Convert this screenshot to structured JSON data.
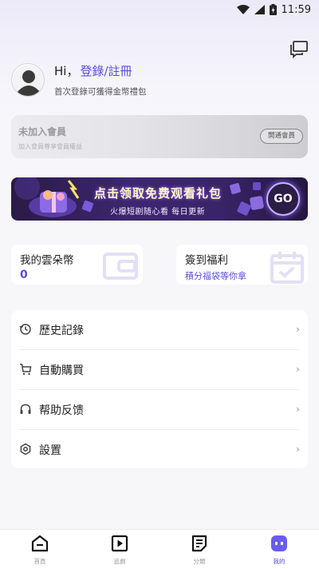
{
  "status_bar": {
    "time": "11:59"
  },
  "profile": {
    "greeting": "Hi，",
    "login_label": "登錄/註冊",
    "subtitle": "首次登錄可獲得金幣禮包"
  },
  "vip": {
    "title": "未加入會員",
    "subtitle": "加入會員尊享會員權益",
    "button_label": "開通會員"
  },
  "banner": {
    "title": "点击领取免费观看礼包",
    "subtitle": "火爆短剧随心看  每日更新",
    "go_label": "GO"
  },
  "cards": {
    "coins": {
      "title": "我的雲朵幣",
      "value": "0"
    },
    "signin": {
      "title": "簽到福利",
      "subtitle": "積分福袋等你拿"
    }
  },
  "menu": {
    "items": [
      {
        "label": "歷史記錄",
        "icon": "history-icon"
      },
      {
        "label": "自動購買",
        "icon": "cart-icon"
      },
      {
        "label": "帮助反馈",
        "icon": "headset-icon"
      },
      {
        "label": "設置",
        "icon": "settings-icon"
      }
    ],
    "arrow": "›"
  },
  "tabbar": {
    "tabs": [
      {
        "label": "首頁",
        "icon": "home-icon",
        "active": false
      },
      {
        "label": "追劇",
        "icon": "play-icon",
        "active": false
      },
      {
        "label": "分類",
        "icon": "list-icon",
        "active": false
      },
      {
        "label": "我的",
        "icon": "profile-tab-icon",
        "active": true
      }
    ]
  },
  "colors": {
    "accent": "#5a4de0",
    "background": "#f7f7fa"
  }
}
